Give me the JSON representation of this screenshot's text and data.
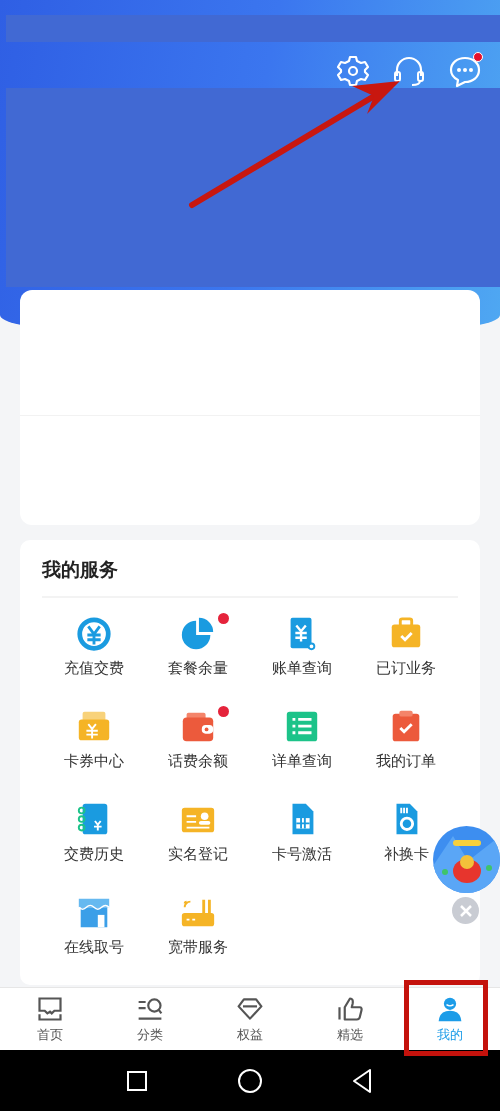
{
  "header": {
    "message_unread": true
  },
  "services": {
    "title": "我的服务",
    "items": [
      {
        "label": "充值交费",
        "badge": false
      },
      {
        "label": "套餐余量",
        "badge": true
      },
      {
        "label": "账单查询",
        "badge": false
      },
      {
        "label": "已订业务",
        "badge": false
      },
      {
        "label": "卡券中心",
        "badge": false
      },
      {
        "label": "话费余额",
        "badge": true
      },
      {
        "label": "详单查询",
        "badge": false
      },
      {
        "label": "我的订单",
        "badge": false
      },
      {
        "label": "交费历史",
        "badge": false
      },
      {
        "label": "实名登记",
        "badge": false
      },
      {
        "label": "卡号激活",
        "badge": false
      },
      {
        "label": "补换卡",
        "badge": false
      },
      {
        "label": "在线取号",
        "badge": false
      },
      {
        "label": "宽带服务",
        "badge": false
      }
    ]
  },
  "tabs": [
    {
      "label": "首页",
      "selected": false
    },
    {
      "label": "分类",
      "selected": false
    },
    {
      "label": "权益",
      "selected": false
    },
    {
      "label": "精选",
      "selected": false
    },
    {
      "label": "我的",
      "selected": true
    }
  ]
}
